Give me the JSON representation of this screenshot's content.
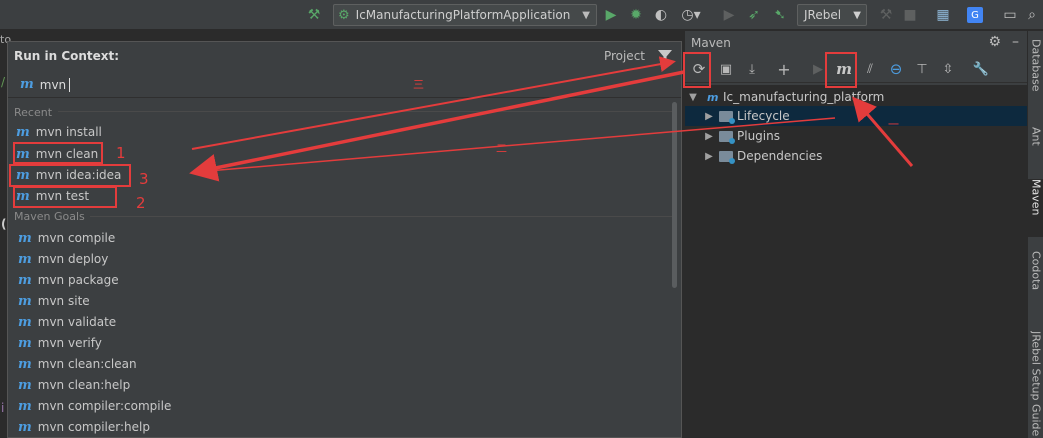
{
  "toolbar": {
    "run_config_label": "IcManufacturingPlatformApplication",
    "jrebel_label": "JRebel",
    "icons": [
      "hammer-icon",
      "run-config-icon",
      "run-icon",
      "debug-icon",
      "coverage-icon",
      "profile-icon",
      "stop-icon",
      "jrebel-run-icon",
      "jrebel-debug-icon",
      "project-structure-icon",
      "translate-icon",
      "terminal-icon"
    ]
  },
  "editor": {
    "tab_fragment": "to",
    "gutter_chars": [
      "/",
      "(",
      "i"
    ]
  },
  "popup": {
    "title": "Run in Context:",
    "scope": "Project",
    "search_prefix": "m",
    "search_value": "mvn",
    "recent_header": "Recent",
    "goals_header": "Maven Goals",
    "recent": [
      {
        "label": "mvn install"
      },
      {
        "label": "mvn clean"
      },
      {
        "label": "mvn idea:idea"
      },
      {
        "label": "mvn test"
      }
    ],
    "goals": [
      {
        "label": "mvn compile"
      },
      {
        "label": "mvn deploy"
      },
      {
        "label": "mvn package"
      },
      {
        "label": "mvn site"
      },
      {
        "label": "mvn validate"
      },
      {
        "label": "mvn verify"
      },
      {
        "label": "mvn clean:clean"
      },
      {
        "label": "mvn clean:help"
      },
      {
        "label": "mvn compiler:compile"
      },
      {
        "label": "mvn compiler:help"
      }
    ],
    "icon_glyph": "m"
  },
  "maven": {
    "title": "Maven",
    "toolbar_icons": [
      "reload-icon",
      "generate-sources-icon",
      "download-icon",
      "add-icon",
      "run-icon",
      "execute-goal-icon",
      "toggle-offline-icon",
      "skip-tests-icon",
      "show-dependencies-icon",
      "collapse-all-icon",
      "settings-wrench-icon"
    ],
    "tree": {
      "root": "Ic_manufacturing_platform",
      "children": [
        {
          "label": "Lifecycle"
        },
        {
          "label": "Plugins"
        },
        {
          "label": "Dependencies"
        }
      ]
    }
  },
  "side_tabs": [
    {
      "label": "Database"
    },
    {
      "label": "Ant"
    },
    {
      "label": "Maven"
    },
    {
      "label": "Codota"
    },
    {
      "label": "JRebel Setup Guide"
    }
  ],
  "annotations": {
    "numbers": [
      "1",
      "2",
      "3"
    ],
    "dashes": [
      "一",
      "二",
      "三"
    ]
  },
  "colors": {
    "accent_blue": "#4d9de0",
    "annotation_red": "#e43c3c",
    "run_green": "#59a869",
    "selection": "#0d293e"
  }
}
